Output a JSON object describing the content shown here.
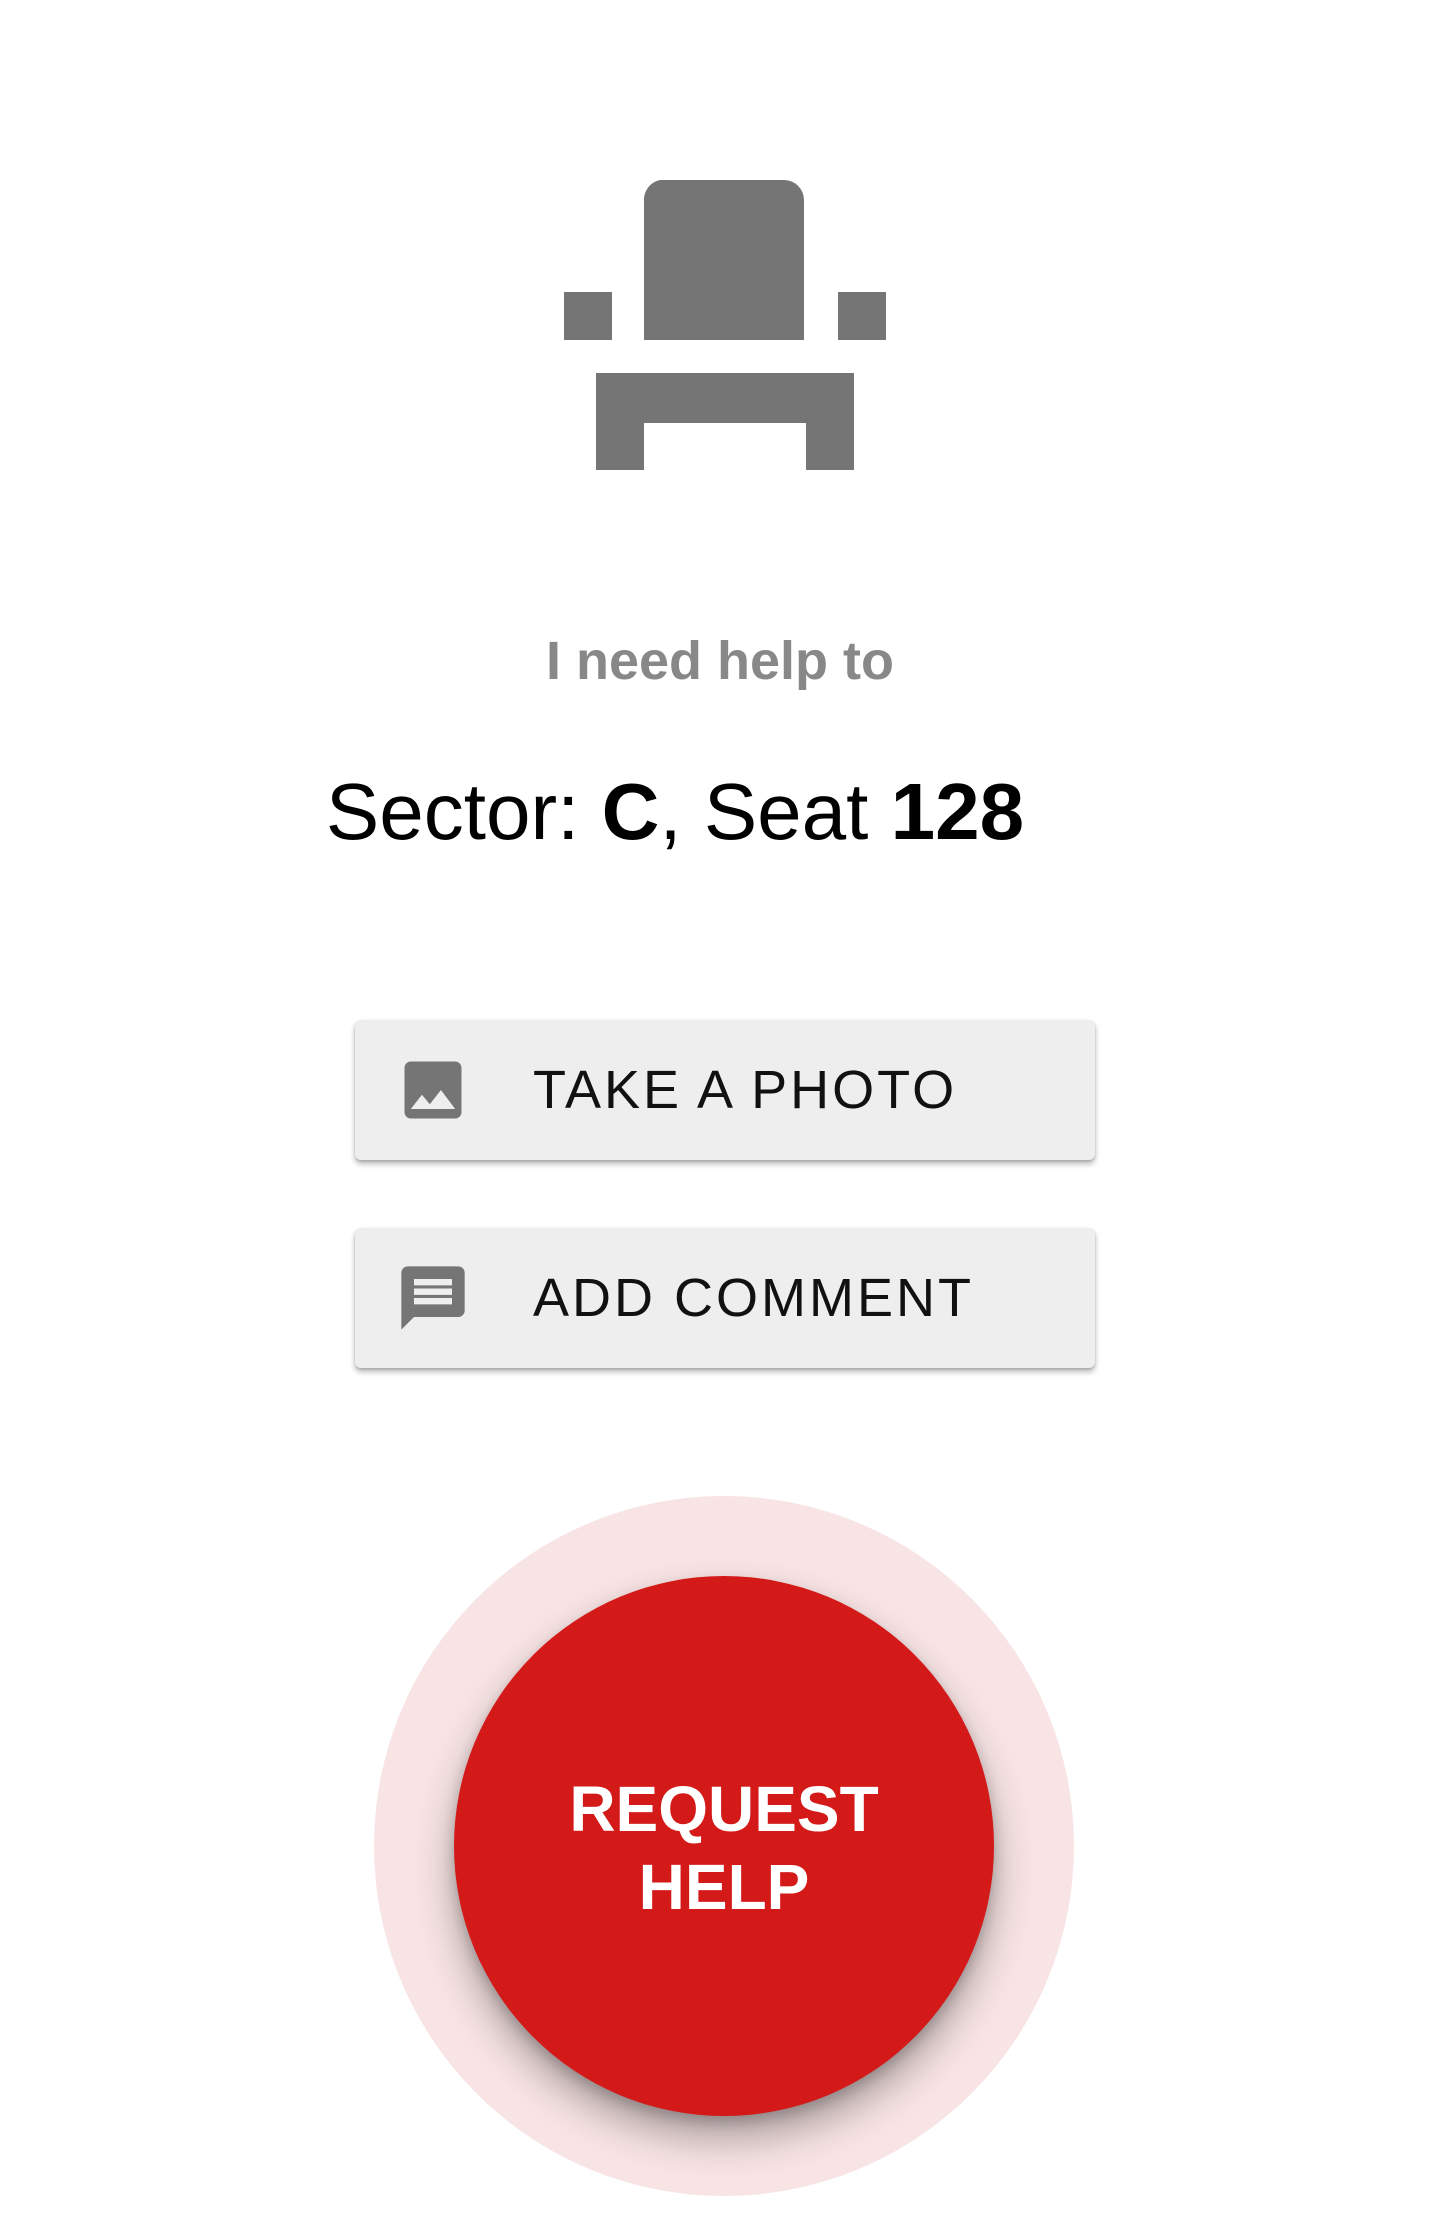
{
  "icons": {
    "seat": "seat-icon",
    "photo": "image-icon",
    "comment": "comment-icon"
  },
  "prompt_text": "I need help to",
  "location": {
    "sector_label": "Sector: ",
    "sector_value": "C",
    "separator": ", Seat ",
    "seat_value": "128"
  },
  "actions": {
    "photo_label": "TAKE A PHOTO",
    "comment_label": "ADD COMMENT"
  },
  "request_help": {
    "line1": "REQUEST",
    "line2": "HELP"
  },
  "colors": {
    "icon_gray": "#757575",
    "button_bg": "#eeeeee",
    "accent_red": "#d41919",
    "halo_pink": "#f8e4e4"
  }
}
